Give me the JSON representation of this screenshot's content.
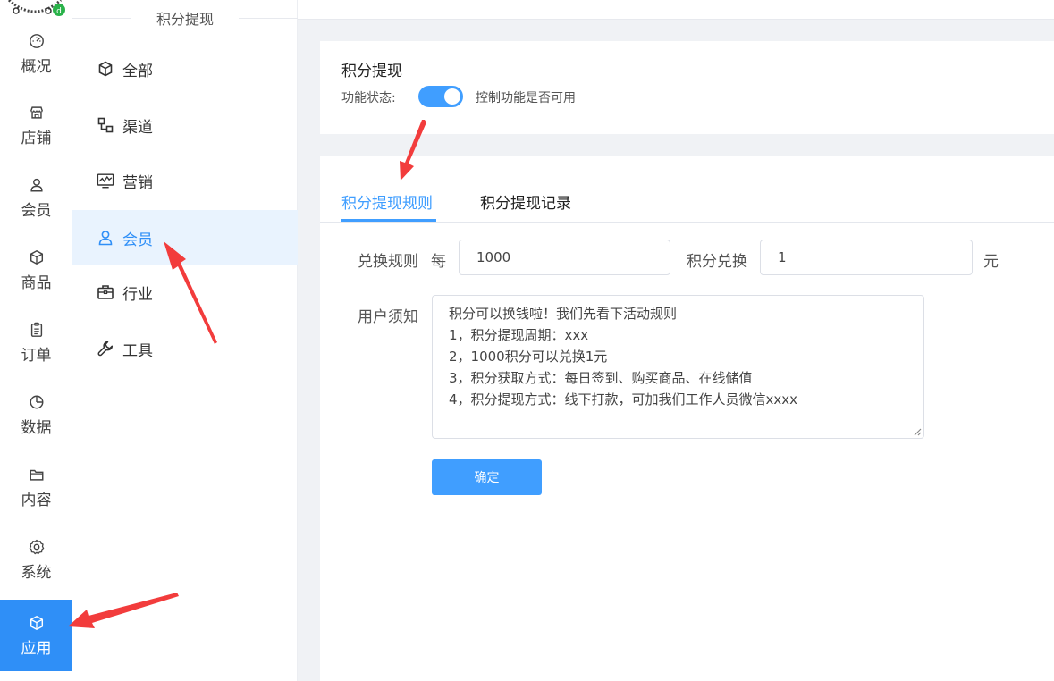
{
  "rail": {
    "items": [
      {
        "label": "概况",
        "icon": "dashboard-icon"
      },
      {
        "label": "店铺",
        "icon": "store-icon"
      },
      {
        "label": "会员",
        "icon": "user-icon"
      },
      {
        "label": "商品",
        "icon": "box-icon"
      },
      {
        "label": "订单",
        "icon": "clipboard-icon"
      },
      {
        "label": "数据",
        "icon": "pie-icon"
      },
      {
        "label": "内容",
        "icon": "folder-icon"
      },
      {
        "label": "系统",
        "icon": "gear-icon"
      },
      {
        "label": "应用",
        "icon": "box-icon"
      }
    ],
    "active_index": 8
  },
  "submenu": {
    "title": "积分提现",
    "items": [
      {
        "label": "全部",
        "icon": "box-icon"
      },
      {
        "label": "渠道",
        "icon": "channel-icon"
      },
      {
        "label": "营销",
        "icon": "chart-monitor-icon"
      },
      {
        "label": "会员",
        "icon": "user-icon"
      },
      {
        "label": "行业",
        "icon": "briefcase-icon"
      },
      {
        "label": "工具",
        "icon": "wrench-icon"
      }
    ],
    "active_index": 3
  },
  "feature": {
    "title": "积分提现",
    "status_label": "功能状态:",
    "enabled": true,
    "description": "控制功能是否可用"
  },
  "tabs": [
    {
      "label": "积分提现规则",
      "active": true
    },
    {
      "label": "积分提现记录",
      "active": false
    }
  ],
  "form": {
    "rule_label": "兑换规则",
    "per_label": "每",
    "points_value": "1000",
    "exchange_label": "积分兑换",
    "money_value": "1",
    "unit_label": "元",
    "notice_label": "用户须知",
    "notice_lines": [
      "积分可以换钱啦！我们先看下活动规则",
      "1，积分提现周期：xxx",
      "2，1000积分可以兑换1元",
      "3，积分获取方式：每日签到、购买商品、在线储值",
      "4，积分提现方式：线下打款，可加我们工作人员微信xxxx"
    ],
    "submit_label": "确定"
  },
  "colors": {
    "accent": "#409eff",
    "rail_active": "#2f8ff7",
    "annotation": "#f23c3c"
  }
}
